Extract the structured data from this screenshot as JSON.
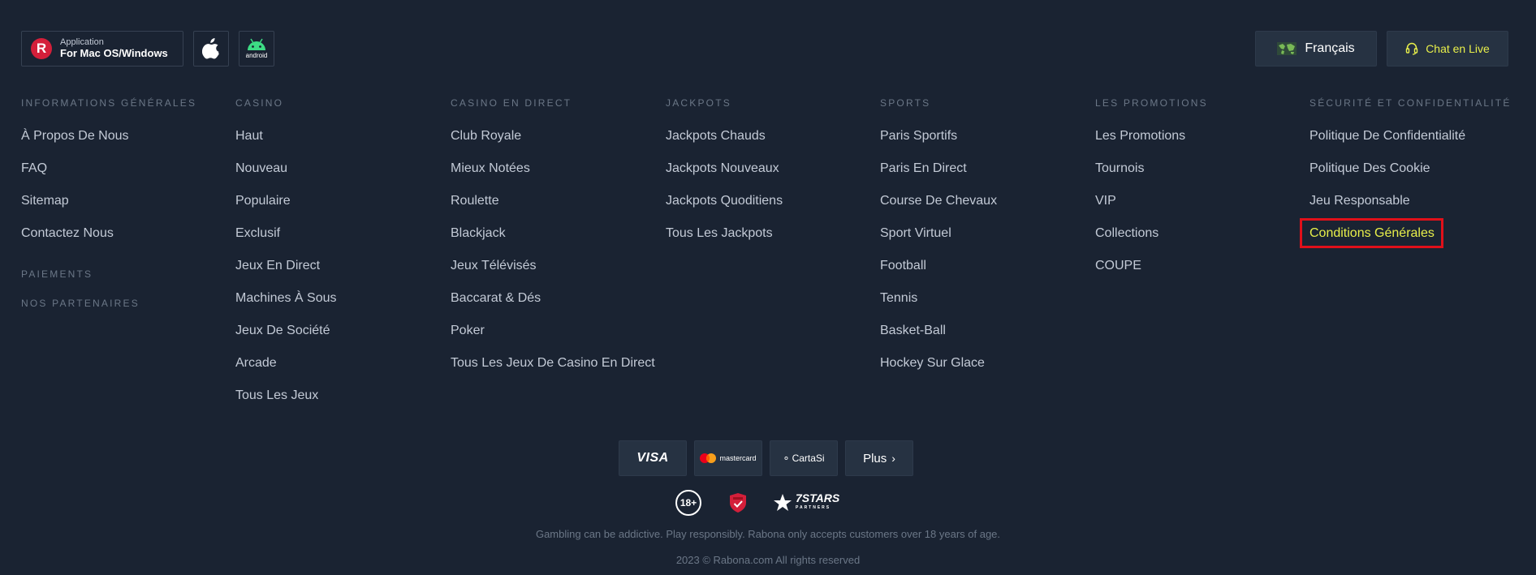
{
  "topbar": {
    "app_small": "Application",
    "app_big": "For Mac OS/Windows",
    "app_logo_letter": "R",
    "android_label": "android",
    "language": "Français",
    "chat": "Chat en Live"
  },
  "columns": [
    {
      "title": "Informations Générales",
      "items": [
        "À Propos De Nous",
        "FAQ",
        "Sitemap",
        "Contactez Nous"
      ],
      "sub_headings": [
        "Paiements",
        "Nos Partenaires"
      ]
    },
    {
      "title": "Casino",
      "items": [
        "Haut",
        "Nouveau",
        "Populaire",
        "Exclusif",
        "Jeux En Direct",
        "Machines À Sous",
        "Jeux De Société",
        "Arcade",
        "Tous Les Jeux"
      ]
    },
    {
      "title": "Casino En Direct",
      "items": [
        "Club Royale",
        "Mieux Notées",
        "Roulette",
        "Blackjack",
        "Jeux Télévisés",
        "Baccarat & Dés",
        "Poker",
        "Tous Les Jeux De Casino En Direct"
      ]
    },
    {
      "title": "Jackpots",
      "items": [
        "Jackpots Chauds",
        "Jackpots Nouveaux",
        "Jackpots Quoditiens",
        "Tous Les Jackpots"
      ]
    },
    {
      "title": "Sports",
      "items": [
        "Paris Sportifs",
        "Paris En Direct",
        "Course De Chevaux",
        "Sport Virtuel",
        "Football",
        "Tennis",
        "Basket-Ball",
        "Hockey Sur Glace"
      ]
    },
    {
      "title": "Les Promotions",
      "items": [
        "Les Promotions",
        "Tournois",
        "VIP",
        "Collections",
        "COUPE"
      ]
    },
    {
      "title": "Sécurité Et Confidentialité",
      "items": [
        "Politique De Confidentialité",
        "Politique Des Cookie",
        "Jeu Responsable",
        "Conditions Générales"
      ],
      "highlighted_index": 3
    }
  ],
  "payments": {
    "visa": "VISA",
    "mastercard": "mastercard",
    "cartasi": "CartaSi",
    "more": "Plus"
  },
  "badges": {
    "age": "18+",
    "partner_main": "7STARS",
    "partner_sub": "PARTNERS"
  },
  "footer": {
    "disclaimer": "Gambling can be addictive. Play responsibly. Rabona only accepts customers over 18 years of age.",
    "copyright": "2023 © Rabona.com All rights reserved"
  },
  "colors": {
    "background": "#1a2332",
    "accent_yellow": "#e8ef4a",
    "highlight_border": "#e0101a",
    "brand_red": "#d41f3a"
  }
}
